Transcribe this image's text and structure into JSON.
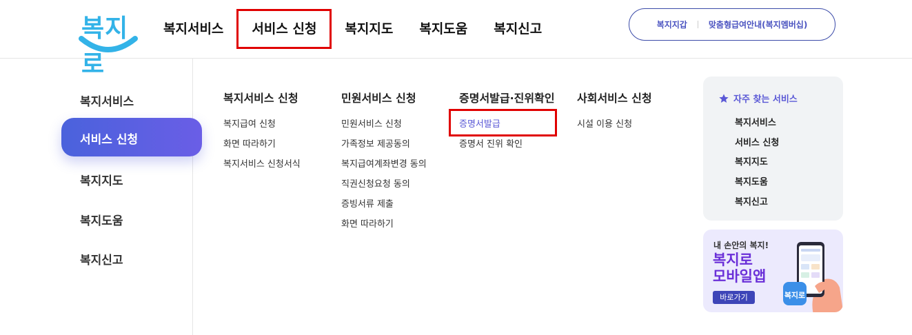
{
  "header": {
    "logo_text": "복지로",
    "gnb": [
      "복지서비스",
      "서비스 신청",
      "복지지도",
      "복지도움",
      "복지신고"
    ],
    "util": [
      "복지지갑",
      "맞춤형급여안내(복지멤버십)"
    ]
  },
  "lnb": {
    "items": [
      "복지서비스",
      "서비스 신청",
      "복지지도",
      "복지도움",
      "복지신고"
    ],
    "active": "서비스 신청"
  },
  "submenu": {
    "col1": {
      "title": "복지서비스 신청",
      "links": [
        "복지급여 신청",
        "화면 따라하기",
        "복지서비스 신청서식"
      ]
    },
    "col2": {
      "title": "민원서비스 신청",
      "links": [
        "민원서비스 신청",
        "가족정보 제공동의",
        "복지급여계좌변경 동의",
        "직권신청요청 동의",
        "증빙서류 제출",
        "화면 따라하기"
      ]
    },
    "col3": {
      "title": "증명서발급·진위확인",
      "links": [
        "증명서발급",
        "증명서 진위 확인"
      ]
    },
    "col4": {
      "title": "사회서비스 신청",
      "links": [
        "시설 이용 신청"
      ]
    }
  },
  "favorites": {
    "title": "자주 찾는 서비스",
    "links": [
      "복지서비스",
      "서비스 신청",
      "복지지도",
      "복지도움",
      "복지신고"
    ]
  },
  "banner": {
    "subtitle": "내 손안의 복지!",
    "title_line1": "복지로",
    "title_line2": "모바일앱",
    "button": "바로가기",
    "phone_logo": "복지로"
  },
  "colors": {
    "accent": "#5a58d6",
    "highlight_box": "#e00000",
    "active_gradient_start": "#4a62dc",
    "active_gradient_end": "#6a5ee6"
  }
}
